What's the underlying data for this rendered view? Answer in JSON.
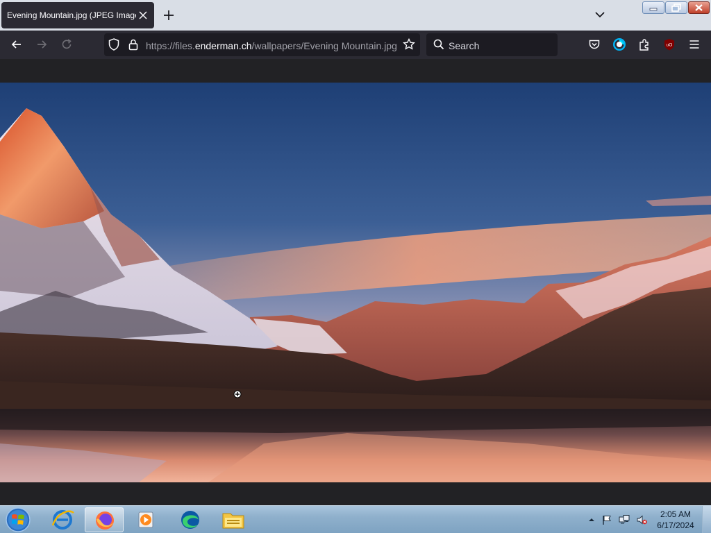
{
  "tab": {
    "title": "Evening Mountain.jpg (JPEG Image",
    "close_icon": "close-icon"
  },
  "navbar": {
    "url_prefix": "https://files.",
    "url_host": "enderman.ch",
    "url_path": "/wallpapers/Evening Mountain.jpg",
    "search_placeholder": "Search",
    "icons": [
      "back-icon",
      "forward-icon",
      "reload-icon",
      "shield-icon",
      "lock-icon",
      "star-icon",
      "search-icon",
      "pocket-icon",
      "account-icon",
      "extensions-icon",
      "ublock-icon",
      "menu-icon"
    ],
    "ublock_label": "uO"
  },
  "image": {
    "name": "Evening Mountain.jpg"
  },
  "taskbar": {
    "apps": [
      "internet-explorer",
      "firefox",
      "media-player",
      "edge",
      "file-explorer"
    ],
    "active_app": "firefox",
    "clock": {
      "time": "2:05 AM",
      "date": "6/17/2024"
    }
  },
  "colors": {
    "toolbar": "#2b2a33",
    "urlbar": "#1c1b22",
    "tabstrip": "#d9dee6",
    "taskbar": "#8fb0cc"
  }
}
